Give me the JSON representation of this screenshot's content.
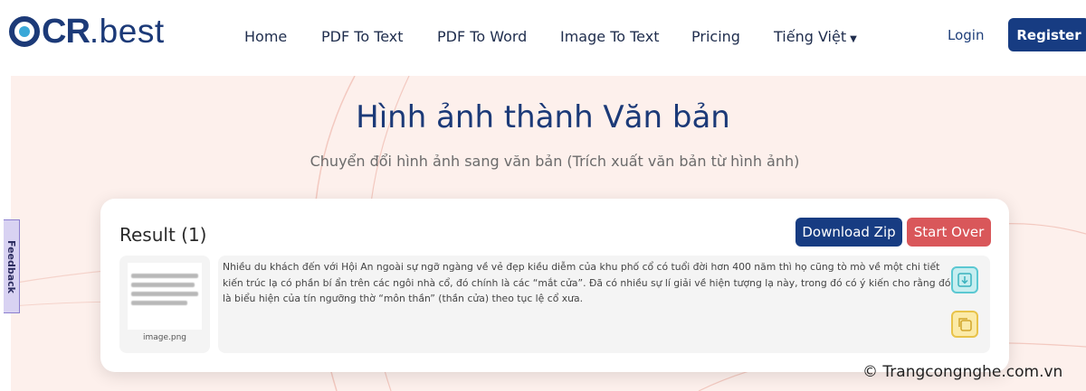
{
  "header": {
    "logo_prefix": "CR",
    "logo_suffix": ".best",
    "nav": [
      {
        "label": "Home"
      },
      {
        "label": "PDF To Text"
      },
      {
        "label": "PDF To Word"
      },
      {
        "label": "Image To Text"
      },
      {
        "label": "Pricing"
      },
      {
        "label": "Tiếng Việt"
      }
    ],
    "login_label": "Login",
    "register_label": "Register"
  },
  "hero": {
    "title": "Hình ảnh thành Văn bản",
    "subtitle": "Chuyển đổi hình ảnh sang văn bản (Trích xuất văn bản từ hình ảnh)"
  },
  "feedback_label": "Feedback",
  "result": {
    "title": "Result (1)",
    "download_zip_label": "Download Zip",
    "start_over_label": "Start Over",
    "file_name": "image.png",
    "extracted_text": "Nhiều du khách đến với Hội An ngoài sự ngỡ ngàng về vẻ đẹp kiều diễm của khu phố cổ có tuổi đời hơn 400 năm thì họ cũng tò mò về một chi tiết kiến trúc lạ có phần bí ẩn trên các ngôi nhà cổ, đó chính là các “mắt cửa”. Đã có nhiều sự lí giải về hiện tượng lạ này, trong đó có ý kiến cho rằng đó là biểu hiện của tín ngưỡng thờ “môn thần” (thần cửa) theo tục lệ cổ xưa.",
    "icons": {
      "download": "download-icon",
      "copy": "copy-icon"
    }
  },
  "watermark": "© Trangcongnghe.com.vn",
  "colors": {
    "brand": "#173c82",
    "start_over": "#d9575a",
    "hero_bg": "#fdf0ec",
    "logo_accent": "#3aa8d8"
  }
}
